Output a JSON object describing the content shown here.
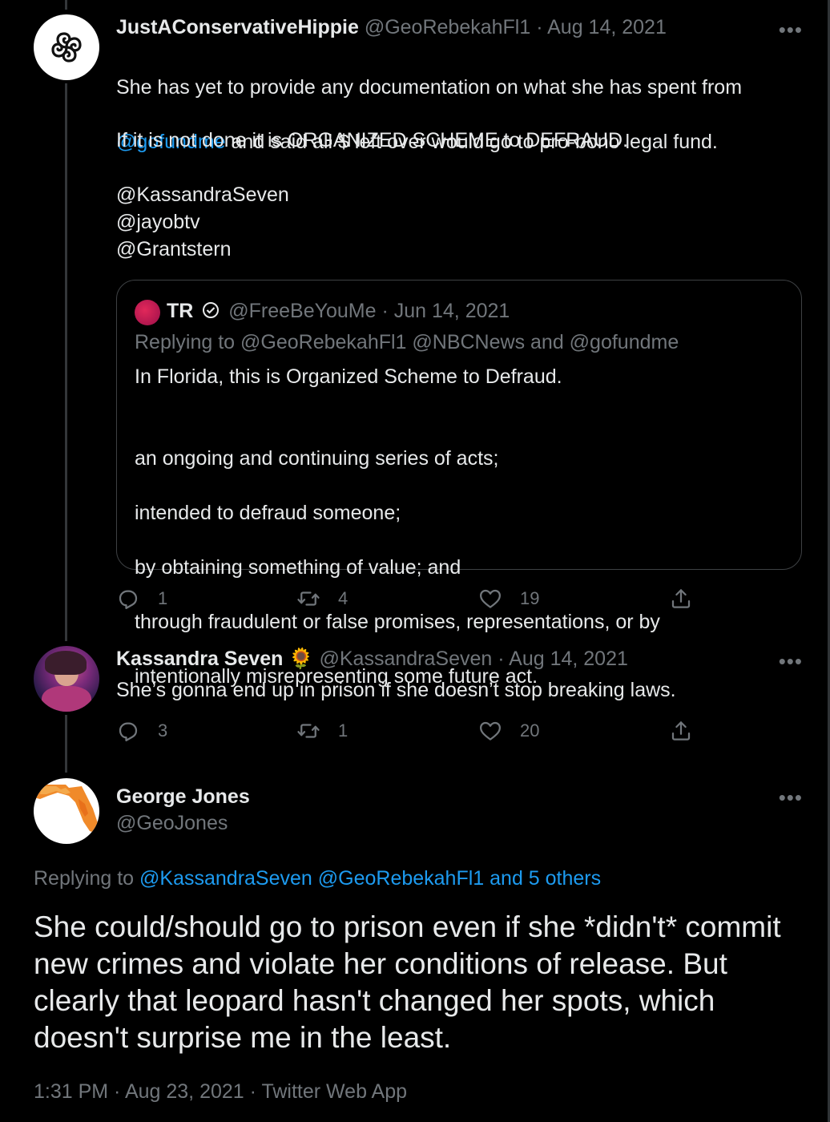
{
  "tweet1": {
    "display_name": "JustAConservativeHippie",
    "handle": "@GeoRebekahFl1",
    "date": "· Aug 14, 2021",
    "more": "•••",
    "line1": "She has yet to provide any documentation on what she has spent from",
    "mention_gofundme": "@gofundme",
    "line2_rest": " and said all $ left over would go to pro-bono legal fund.",
    "line3": "If it is not done it is ORGANIZED SCHEME to DEFRAUD.",
    "mentions": [
      "@KassandraSeven",
      "@jayobtv",
      "@Grantstern"
    ],
    "quote": {
      "display_name": "TR",
      "handle": "@FreeBeYouMe",
      "date": "· Jun 14, 2021",
      "replying": "Replying to @GeoRebekahFl1 @NBCNews and @gofundme",
      "text_line1": "In Florida, this is Organized Scheme to Defraud.",
      "text_lines": [
        "an ongoing and continuing series of acts;",
        "intended to defraud someone;",
        "by obtaining something of value; and",
        "through fraudulent or false promises, representations, or by",
        "intentionally misrepresenting some future act."
      ]
    },
    "replies": "1",
    "retweets": "4",
    "likes": "19"
  },
  "tweet2": {
    "display_name": "Kassandra Seven",
    "badge": "🌻",
    "handle": "@KassandraSeven",
    "date": "· Aug 14, 2021",
    "more": "•••",
    "text": "She’s gonna end up in prison if she doesn’t stop breaking laws.",
    "replies": "3",
    "retweets": "1",
    "likes": "20"
  },
  "main_tweet": {
    "display_name": "George Jones",
    "handle": "@GeoJones",
    "more": "•••",
    "replying_prefix": "Replying to ",
    "replying_links": "@KassandraSeven @GeoRebekahFl1 and 5 others",
    "text": "She could/should go to prison even if she *didn't* commit new crimes and violate her conditions of release. But clearly that leopard hasn't changed her spots, which doesn't surprise me in the least.",
    "timestamp": "1:31 PM · Aug 23, 2021 · Twitter Web App"
  },
  "icons": [
    "reply-icon",
    "retweet-icon",
    "like-icon",
    "share-icon",
    "more-icon",
    "verified-icon"
  ],
  "colors": {
    "background": "#000000",
    "link": "#1d9bf0",
    "muted": "#71767b",
    "text": "#e7e9ea"
  }
}
